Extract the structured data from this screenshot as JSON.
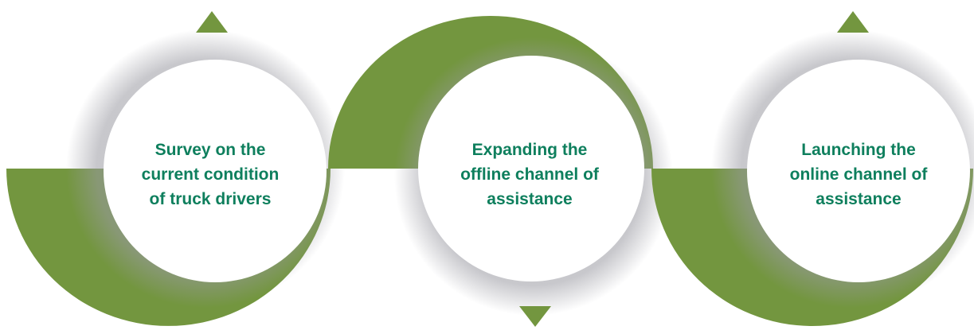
{
  "colors": {
    "ring": "#73963f",
    "ring_dark": "#5f8232",
    "circle": "#ffffff",
    "text": "#0e7f5d"
  },
  "steps": [
    {
      "label": "Survey on the\ncurrent condition\nof truck drivers",
      "ring_half": "bottom",
      "arrow": "up"
    },
    {
      "label": "Expanding the\noffline channel of\nassistance",
      "ring_half": "top",
      "arrow": "down"
    },
    {
      "label": "Launching the\nonline channel of\nassistance",
      "ring_half": "bottom",
      "arrow": "up"
    }
  ]
}
